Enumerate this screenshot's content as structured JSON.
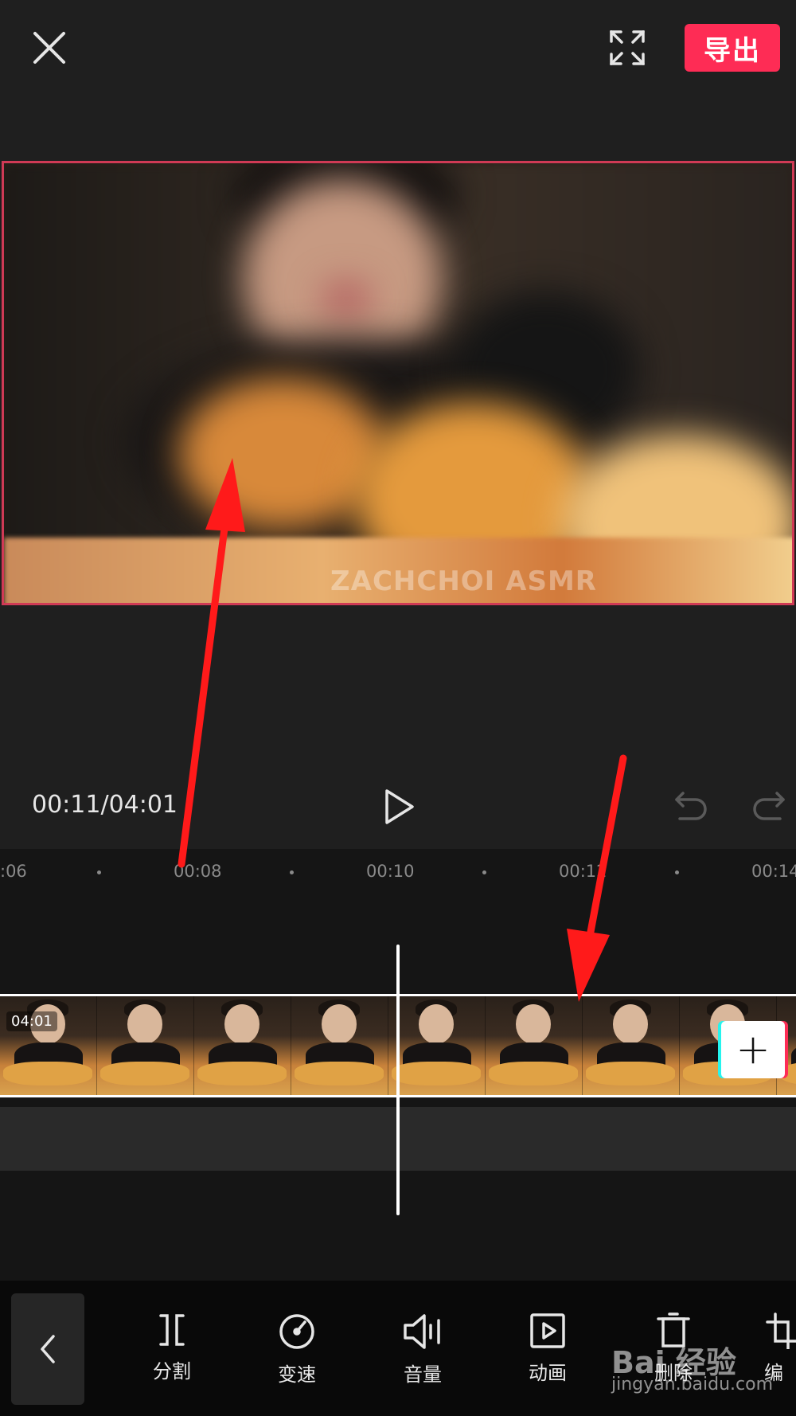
{
  "header": {
    "close_icon": "close-icon",
    "fullscreen_icon": "fullscreen-icon",
    "export_label": "导出",
    "accent": "#fe2c55"
  },
  "preview": {
    "watermark": "ZACHCHOI ASMR"
  },
  "playback": {
    "time_readout": "00:11/04:01",
    "play_icon": "play-icon",
    "undo_icon": "undo-icon",
    "redo_icon": "redo-icon"
  },
  "timeline": {
    "ticks": [
      ":06",
      "00:08",
      "00:10",
      "00:12",
      "00:14"
    ],
    "clip_duration": "04:01",
    "add_clip_icon": "plus-icon"
  },
  "toolbar": {
    "back_icon": "chevron-left-icon",
    "tools": [
      {
        "label": "分割",
        "icon": "split-icon"
      },
      {
        "label": "变速",
        "icon": "speed-icon"
      },
      {
        "label": "音量",
        "icon": "volume-icon"
      },
      {
        "label": "动画",
        "icon": "animation-icon"
      },
      {
        "label": "删除",
        "icon": "delete-icon"
      },
      {
        "label": "编",
        "icon": "edit-icon"
      }
    ]
  },
  "overlay": {
    "baidu_logo": "Bai 经验",
    "baidu_url": "jingyan.baidu.com",
    "arrow_color": "#ff1a1a"
  }
}
